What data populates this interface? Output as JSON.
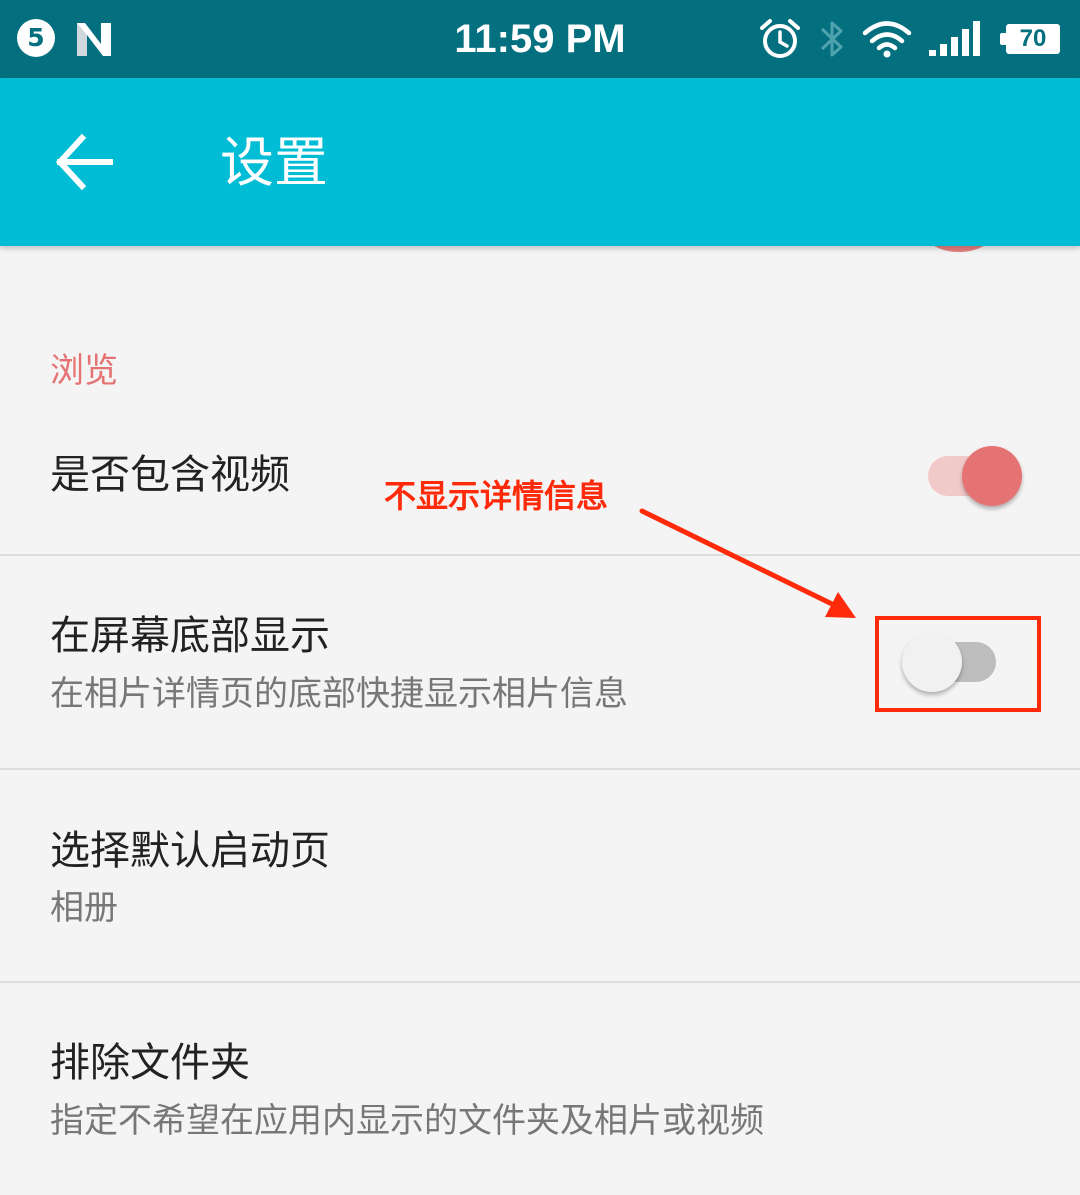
{
  "status_bar": {
    "notification_count": "5",
    "time": "11:59 PM",
    "battery": "70",
    "icons": [
      "notification-badge",
      "n-logo-icon",
      "alarm-icon",
      "bluetooth-icon",
      "wifi-icon",
      "signal-icon",
      "battery-icon"
    ]
  },
  "app_bar": {
    "back_icon": "arrow-left-icon",
    "title": "设置"
  },
  "browse_section": {
    "header": "浏览",
    "include_video": {
      "title": "是否包含视频",
      "enabled": true
    },
    "show_at_bottom": {
      "title": "在屏幕底部显示",
      "subtitle": "在相片详情页的底部快捷显示相片信息",
      "enabled": false
    },
    "default_start_page": {
      "title": "选择默认启动页",
      "subtitle": "相册"
    },
    "exclude_folders": {
      "title": "排除文件夹",
      "subtitle": "指定不希望在应用内显示的文件夹及相片或视频"
    }
  },
  "annotation": {
    "text": "不显示详情信息"
  },
  "colors": {
    "status_bar": "#036f7f",
    "app_bar": "#00bcd4",
    "accent": "#e57373",
    "annotation": "#ff2a0a",
    "background": "#f4f4f4"
  }
}
